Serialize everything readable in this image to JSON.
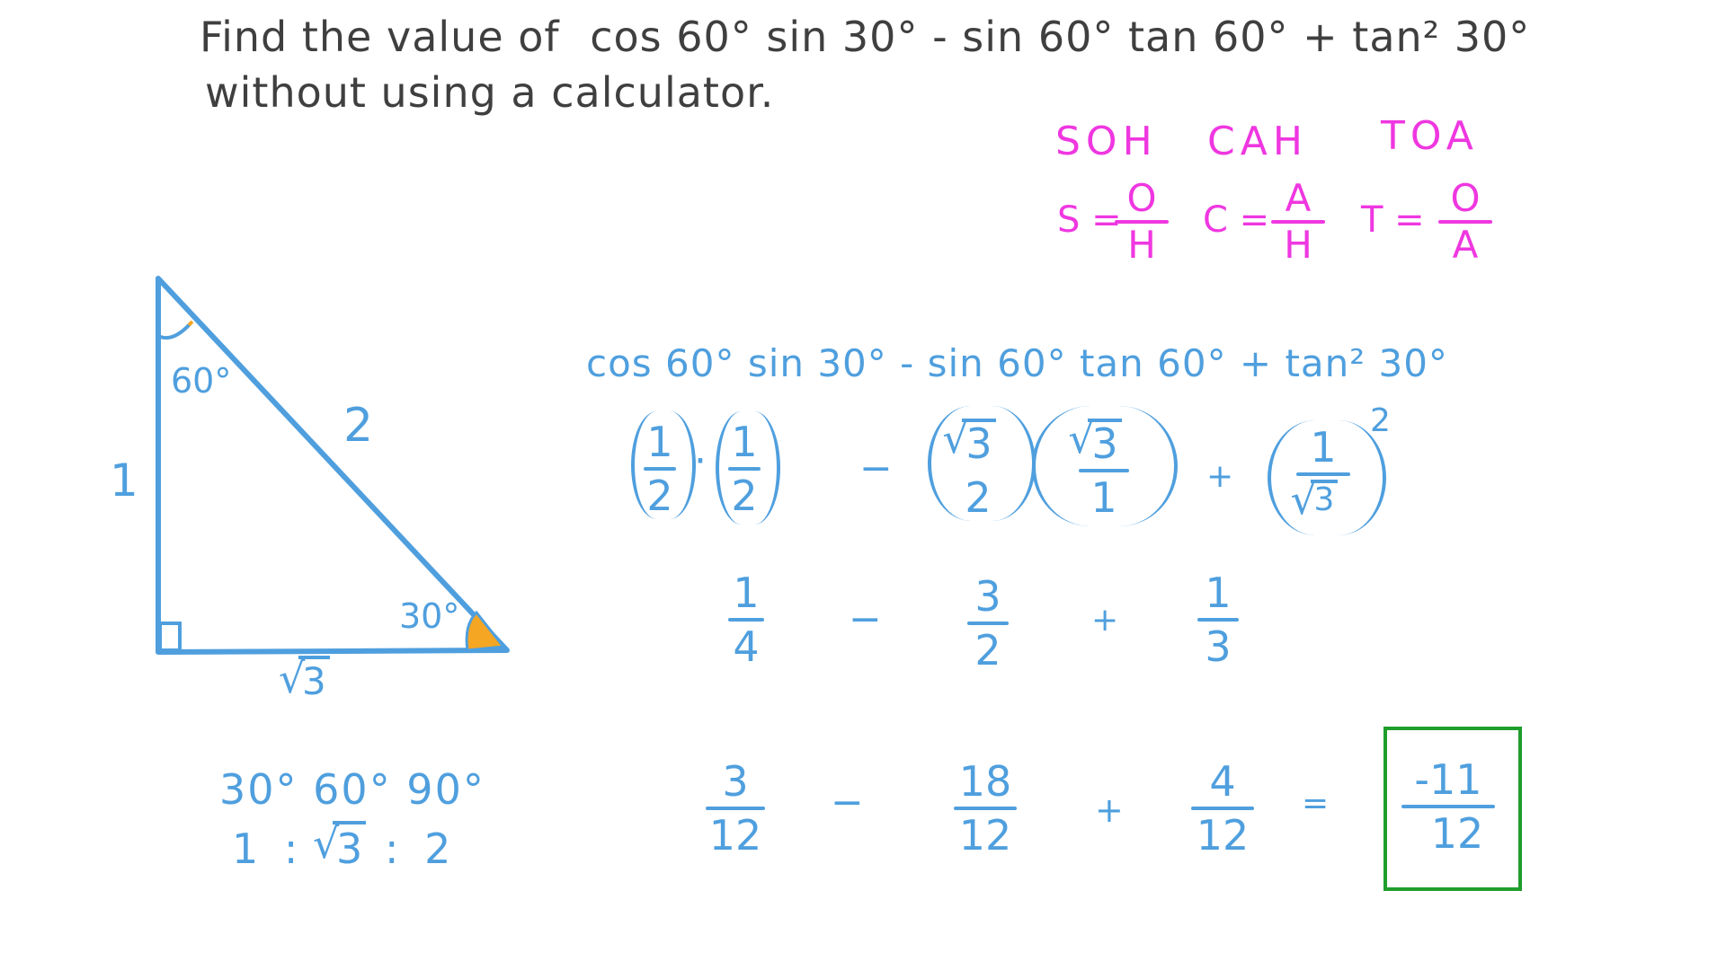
{
  "problem": {
    "line1_prefix": "Find the value of",
    "line1_expression": "cos 60° sin 30° - sin 60° tan 60° + tan² 30°",
    "line2": "without using a calculator."
  },
  "mnemonic": {
    "words": [
      "SOH",
      "CAH",
      "TOA"
    ],
    "formulas": [
      {
        "lhs": "S =",
        "num": "O",
        "den": "H"
      },
      {
        "lhs": "C =",
        "num": "A",
        "den": "H"
      },
      {
        "lhs": "T =",
        "num": "O",
        "den": "A"
      }
    ]
  },
  "triangle": {
    "top_angle": "60°",
    "bottom_angle": "30°",
    "hypotenuse": "2",
    "vertical_side": "1",
    "horizontal_side_radicand": "3",
    "colors": {
      "stroke": "#4f9fde",
      "angle_fill": "#f5a623"
    }
  },
  "ratio": {
    "angles": "30° 60° 90°",
    "side_1": "1",
    "colon": ":",
    "side_2_radicand": "3",
    "side_3": "2"
  },
  "solution": {
    "expression": "cos 60° sin 30° - sin 60° tan 60° + tan² 30°",
    "substitution": {
      "t1": {
        "num": "1",
        "den": "2"
      },
      "dot": "·",
      "t2": {
        "num": "1",
        "den": "2"
      },
      "minus": "−",
      "t3": {
        "num_radicand": "3",
        "den": "2"
      },
      "t4": {
        "num_radicand": "3",
        "den": "1"
      },
      "plus": "+",
      "t5": {
        "num": "1",
        "den_radicand": "3"
      },
      "exponent": "2"
    },
    "simplified": {
      "t1": {
        "num": "1",
        "den": "4"
      },
      "minus": "−",
      "t2": {
        "num": "3",
        "den": "2"
      },
      "plus": "+",
      "t3": {
        "num": "1",
        "den": "3"
      }
    },
    "common_denominator": {
      "t1": {
        "num": "3",
        "den": "12"
      },
      "minus": "−",
      "t2": {
        "num": "18",
        "den": "12"
      },
      "plus": "+",
      "t3": {
        "num": "4",
        "den": "12"
      },
      "equals": "="
    },
    "answer": {
      "num": "-11",
      "den": "12"
    }
  },
  "colors": {
    "text_gray": "#3f3f3f",
    "ink_blue": "#4f9fde",
    "mnemonic_pink": "#ef37e0",
    "answer_box_green": "#1f9e2c",
    "angle_orange": "#f5a623"
  }
}
